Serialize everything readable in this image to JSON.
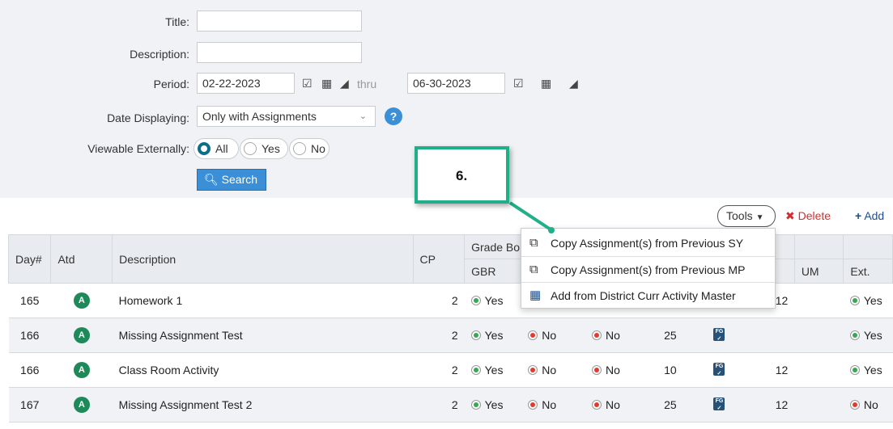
{
  "filters": {
    "title_label": "Title:",
    "title_value": "",
    "description_label": "Description:",
    "description_value": "",
    "period_label": "Period:",
    "period_start": "02-22-2023",
    "period_thru": "thru",
    "period_end": "06-30-2023",
    "date_displaying_label": "Date Displaying:",
    "date_displaying_value": "Only with Assignments",
    "viewable_label": "Viewable Externally:",
    "viewable_options": [
      "All",
      "Yes",
      "No"
    ],
    "viewable_selected": "All",
    "search_label": "Search"
  },
  "callout": {
    "text": "6."
  },
  "toolbar": {
    "tools_label": "Tools",
    "delete_label": "Delete",
    "add_label": "Add"
  },
  "dropdown": {
    "items": [
      "Copy Assignment(s) from Previous SY",
      "Copy Assignment(s) from Previous MP",
      "Add from District Curr Activity Master"
    ]
  },
  "table": {
    "headers": {
      "day": "Day#",
      "atd": "Atd",
      "description": "Description",
      "cp": "CP",
      "grade_book": "Grade Bo",
      "gbr": "GBR",
      "hash": "#",
      "um": "UM",
      "ext": "Ext."
    },
    "rows": [
      {
        "day": "165",
        "atd": "A",
        "description": "Homework 1",
        "cp": "2",
        "gbr": "Yes",
        "c2": "",
        "c3": "",
        "c4": "",
        "num": "12",
        "ext": "Yes"
      },
      {
        "day": "166",
        "atd": "A",
        "description": "Missing Assignment Test",
        "cp": "2",
        "gbr": "Yes",
        "c2": "No",
        "c3": "No",
        "c4": "25",
        "num": "",
        "ext": "Yes"
      },
      {
        "day": "166",
        "atd": "A",
        "description": "Class Room Activity",
        "cp": "2",
        "gbr": "Yes",
        "c2": "No",
        "c3": "No",
        "c4": "10",
        "num": "12",
        "ext": "Yes"
      },
      {
        "day": "167",
        "atd": "A",
        "description": "Missing Assignment Test 2",
        "cp": "2",
        "gbr": "Yes",
        "c2": "No",
        "c3": "No",
        "c4": "25",
        "num": "12",
        "ext": "No"
      }
    ]
  },
  "colors": {
    "accent": "#3a8fd6",
    "callout_border": "#1fb08a",
    "yes": "#36a852",
    "no": "#e23a2e",
    "atd_badge": "#1e8a5a"
  }
}
